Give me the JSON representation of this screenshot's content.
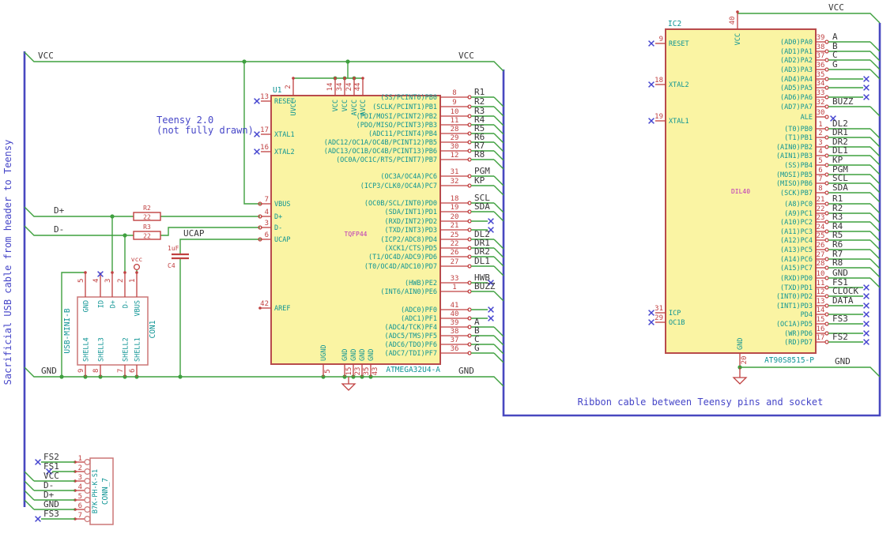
{
  "notes": {
    "sacrificial": "Sacrificial USB cable from header to Teensy",
    "teensy_line1": "Teensy 2.0",
    "teensy_line2": "(not fully drawn)",
    "ribbon": "Ribbon cable between Teensy pins and socket"
  },
  "net_labels": {
    "vcc_top_left": "VCC",
    "vcc_u1_right": "VCC",
    "vcc_ic2_top": "VCC",
    "gnd_left": "GND",
    "gnd_u1_right": "GND",
    "gnd_ic2_right": "GND",
    "dplus": "D+",
    "dminus": "D-",
    "ucap": "UCAP",
    "vcc_power_symbol": "vcc"
  },
  "u1": {
    "ref": "U1",
    "value": "ATMEGA32U4-A",
    "package": "TQFP44",
    "top_pins": [
      {
        "num": "2",
        "name": "UVCC"
      },
      {
        "num": "14",
        "name": "VCC"
      },
      {
        "num": "34",
        "name": "VCC"
      },
      {
        "num": "24",
        "name": "AVCC"
      },
      {
        "num": "44",
        "name": "AVCC"
      }
    ],
    "bottom_pins": [
      {
        "num": "5",
        "name": "UGND"
      },
      {
        "num": "15",
        "name": "GND"
      },
      {
        "num": "23",
        "name": "GND"
      },
      {
        "num": "35",
        "name": "GND"
      },
      {
        "num": "43",
        "name": "GND"
      }
    ],
    "left_pins": [
      {
        "num": "13",
        "name": "RESET",
        "conn": "nc"
      },
      {
        "num": "17",
        "name": "XTAL1",
        "conn": "nc"
      },
      {
        "num": "16",
        "name": "XTAL2",
        "conn": "nc"
      },
      {
        "num": "7",
        "name": "VBUS",
        "conn": "wire"
      },
      {
        "num": "4",
        "name": "D+",
        "conn": "wire"
      },
      {
        "num": "3",
        "name": "D-",
        "conn": "wire"
      },
      {
        "num": "6",
        "name": "UCAP",
        "conn": "wire"
      },
      {
        "num": "42",
        "name": "AREF",
        "conn": "open"
      }
    ],
    "right_pins": [
      {
        "num": "8",
        "name": "(SS/PCINT0)PB0",
        "label": "R1",
        "conn": "bus"
      },
      {
        "num": "9",
        "name": "(SCLK/PCINT1)PB1",
        "label": "R2",
        "conn": "bus"
      },
      {
        "num": "10",
        "name": "(PDI/MOSI/PCINT2)PB2",
        "label": "R3",
        "conn": "bus"
      },
      {
        "num": "11",
        "name": "(PDO/MISO/PCINT3)PB3",
        "label": "R4",
        "conn": "bus"
      },
      {
        "num": "28",
        "name": "(ADC11/PCINT4)PB4",
        "label": "R5",
        "conn": "bus"
      },
      {
        "num": "29",
        "name": "(ADC12/OC1A/OC4B/PCINT12)PB5",
        "label": "R6",
        "conn": "bus"
      },
      {
        "num": "30",
        "name": "(ADC13/OC1B/OC4B/PCINT13)PB6",
        "label": "R7",
        "conn": "bus"
      },
      {
        "num": "12",
        "name": "(OC0A/OC1C/RTS/PCINT7)PB7",
        "label": "R8",
        "conn": "bus"
      },
      {
        "num": "31",
        "name": "(OC3A/OC4A)PC6",
        "label": "PGM",
        "conn": "bus"
      },
      {
        "num": "32",
        "name": "(ICP3/CLK0/OC4A)PC7",
        "label": "KP",
        "conn": "bus"
      },
      {
        "num": "18",
        "name": "(OC0B/SCL/INT0)PD0",
        "label": "SCL",
        "conn": "bus"
      },
      {
        "num": "19",
        "name": "(SDA/INT1)PD1",
        "label": "SDA",
        "conn": "bus"
      },
      {
        "num": "20",
        "name": "(RXD/INT2)PD2",
        "label": "",
        "conn": "nc"
      },
      {
        "num": "21",
        "name": "(TXD/INT3)PD3",
        "label": "",
        "conn": "nc"
      },
      {
        "num": "25",
        "name": "(ICP2/ADC8)PD4",
        "label": "DL2",
        "conn": "bus"
      },
      {
        "num": "22",
        "name": "(XCK1/CTS)PD5",
        "label": "DR1",
        "conn": "bus"
      },
      {
        "num": "26",
        "name": "(T1/OC4D/ADC9)PD6",
        "label": "DR2",
        "conn": "bus"
      },
      {
        "num": "27",
        "name": "(T0/OC4D/ADC10)PD7",
        "label": "DL1",
        "conn": "bus"
      },
      {
        "num": "33",
        "name": "(HWB)PE2",
        "label": "HWB",
        "conn": "nc"
      },
      {
        "num": "1",
        "name": "(INT6/AIN0)PE6",
        "label": "BUZZ",
        "conn": "bus"
      },
      {
        "num": "41",
        "name": "(ADC0)PF0",
        "label": "",
        "conn": "nc"
      },
      {
        "num": "40",
        "name": "(ADC1)PF1",
        "label": "",
        "conn": "nc"
      },
      {
        "num": "39",
        "name": "(ADC4/TCK)PF4",
        "label": "A",
        "conn": "bus"
      },
      {
        "num": "38",
        "name": "(ADC5/TMS)PF5",
        "label": "B",
        "conn": "bus"
      },
      {
        "num": "37",
        "name": "(ADC6/TDO)PF6",
        "label": "C",
        "conn": "bus"
      },
      {
        "num": "36",
        "name": "(ADC7/TDI)PF7",
        "label": "G",
        "conn": "bus"
      }
    ]
  },
  "ic2": {
    "ref": "IC2",
    "value": "AT90S8515-P",
    "package": "DIL40",
    "top_pins": [
      {
        "num": "40",
        "name": "VCC"
      }
    ],
    "bottom_pins": [
      {
        "num": "20",
        "name": "GND"
      }
    ],
    "left_pins": [
      {
        "num": "9",
        "name": "RESET",
        "conn": "nc"
      },
      {
        "num": "18",
        "name": "XTAL2",
        "conn": "nc"
      },
      {
        "num": "19",
        "name": "XTAL1",
        "conn": "nc"
      },
      {
        "num": "31",
        "name": "ICP",
        "conn": "nc"
      },
      {
        "num": "29",
        "name": "OC1B",
        "conn": "nc"
      }
    ],
    "right_pins": [
      {
        "num": "39",
        "name": "(AD0)PA0",
        "label": "A",
        "conn": "bus"
      },
      {
        "num": "38",
        "name": "(AD1)PA1",
        "label": "B",
        "conn": "bus"
      },
      {
        "num": "37",
        "name": "(AD2)PA2",
        "label": "C",
        "conn": "bus"
      },
      {
        "num": "36",
        "name": "(AD3)PA3",
        "label": "G",
        "conn": "bus"
      },
      {
        "num": "35",
        "name": "(AD4)PA4",
        "label": "",
        "conn": "nc"
      },
      {
        "num": "34",
        "name": "(AD5)PA5",
        "label": "",
        "conn": "nc"
      },
      {
        "num": "33",
        "name": "(AD6)PA6",
        "label": "",
        "conn": "nc"
      },
      {
        "num": "32",
        "name": "(AD7)PA7",
        "label": "BUZZ",
        "conn": "bus"
      },
      {
        "num": "30",
        "name": "ALE",
        "label": "",
        "conn": "ncpin"
      },
      {
        "num": "1",
        "name": "(T0)PB0",
        "label": "DL2",
        "conn": "bus"
      },
      {
        "num": "2",
        "name": "(T1)PB1",
        "label": "DR1",
        "conn": "bus"
      },
      {
        "num": "3",
        "name": "(AIN0)PB2",
        "label": "DR2",
        "conn": "bus"
      },
      {
        "num": "4",
        "name": "(AIN1)PB3",
        "label": "DL1",
        "conn": "bus"
      },
      {
        "num": "5",
        "name": "(SS)PB4",
        "label": "KP",
        "conn": "bus"
      },
      {
        "num": "6",
        "name": "(MOSI)PB5",
        "label": "PGM",
        "conn": "bus"
      },
      {
        "num": "7",
        "name": "(MISO)PB6",
        "label": "SCL",
        "conn": "bus"
      },
      {
        "num": "8",
        "name": "(SCK)PB7",
        "label": "SDA",
        "conn": "bus"
      },
      {
        "num": "21",
        "name": "(A8)PC0",
        "label": "R1",
        "conn": "bus"
      },
      {
        "num": "22",
        "name": "(A9)PC1",
        "label": "R2",
        "conn": "bus"
      },
      {
        "num": "23",
        "name": "(A10)PC2",
        "label": "R3",
        "conn": "bus"
      },
      {
        "num": "24",
        "name": "(A11)PC3",
        "label": "R4",
        "conn": "bus"
      },
      {
        "num": "25",
        "name": "(A12)PC4",
        "label": "R5",
        "conn": "bus"
      },
      {
        "num": "26",
        "name": "(A13)PC5",
        "label": "R6",
        "conn": "bus"
      },
      {
        "num": "27",
        "name": "(A14)PC6",
        "label": "R7",
        "conn": "bus"
      },
      {
        "num": "28",
        "name": "(A15)PC7",
        "label": "R8",
        "conn": "bus"
      },
      {
        "num": "10",
        "name": "(RXD)PD0",
        "label": "GND",
        "conn": "bus"
      },
      {
        "num": "11",
        "name": "(TXD)PD1",
        "label": "FS1",
        "conn": "nc"
      },
      {
        "num": "12",
        "name": "(INT0)PD2",
        "label": "CLOCK",
        "conn": "nc"
      },
      {
        "num": "13",
        "name": "(INT1)PD3",
        "label": "DATA",
        "conn": "nc"
      },
      {
        "num": "14",
        "name": "PD4",
        "label": "",
        "conn": "nc"
      },
      {
        "num": "15",
        "name": "(OC1A)PD5",
        "label": "FS3",
        "conn": "nc"
      },
      {
        "num": "16",
        "name": "(WR)PD6",
        "label": "",
        "conn": "nc"
      },
      {
        "num": "17",
        "name": "(RD)PD7",
        "label": "FS2",
        "conn": "nc"
      }
    ]
  },
  "con1": {
    "ref": "CON1",
    "value": "USB-MINI-B",
    "top_pins": [
      {
        "num": "5",
        "name": "GND"
      },
      {
        "num": "4",
        "name": "ID"
      },
      {
        "num": "3",
        "name": "D+"
      },
      {
        "num": "2",
        "name": "D-"
      },
      {
        "num": "1",
        "name": "VBUS"
      }
    ],
    "bottom_pins": [
      {
        "num": "9",
        "name": "SHELL4"
      },
      {
        "num": "8",
        "name": "SHELL3"
      },
      {
        "num": "7",
        "name": "SHELL2"
      },
      {
        "num": "6",
        "name": "SHELL1"
      }
    ]
  },
  "conn7": {
    "ref": "CONN_7",
    "value": "B7K-PH-K-S1",
    "pins": [
      {
        "num": "1",
        "label": "FS2",
        "nc": true
      },
      {
        "num": "2",
        "label": "FS1",
        "nc": true
      },
      {
        "num": "3",
        "label": "VCC",
        "nc": false
      },
      {
        "num": "4",
        "label": "D-",
        "nc": false
      },
      {
        "num": "5",
        "label": "D+",
        "nc": false
      },
      {
        "num": "6",
        "label": "GND",
        "nc": false
      },
      {
        "num": "7",
        "label": "FS3",
        "nc": true
      }
    ]
  },
  "r2": {
    "ref": "R2",
    "value": "22"
  },
  "r3": {
    "ref": "R3",
    "value": "22"
  },
  "c4": {
    "ref": "C4",
    "value": "1uF"
  },
  "colors": {
    "wire": "#3FA03F",
    "bus": "#4848C0",
    "chip_fill": "#FAF4A3",
    "chip_stroke": "#B84B4B",
    "pin_red": "#C04040",
    "teal": "#0E9494",
    "label": "#373737",
    "magenta": "#BB2FBB",
    "note_blue": "#4646C8",
    "nc_blue": "#4545CF"
  }
}
